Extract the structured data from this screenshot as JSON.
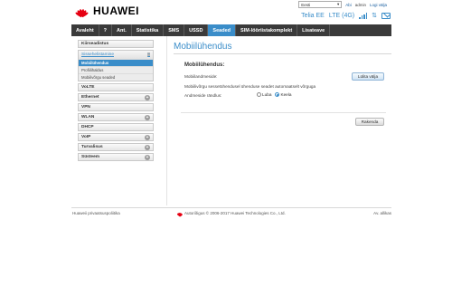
{
  "brand": {
    "name": "HUAWEI",
    "color": "#e60012"
  },
  "topbar": {
    "language": "Eesti",
    "user_label": "Abi",
    "admin": "admin",
    "logout": "Logi välja"
  },
  "status": {
    "operator": "Telia EE",
    "network": "LTE (4G)",
    "icons": [
      "signal-icon",
      "data-transfer-icon",
      "sms-icon"
    ]
  },
  "nav": {
    "items": [
      "Avaleht",
      "?",
      "Ant.",
      "Statistika",
      "SMS",
      "USSD",
      "Seaded",
      "SIM-lööriistakomplekt",
      "Lisateave"
    ],
    "active_index": 6
  },
  "sidebar": {
    "top_item": "Kiirseadistus",
    "group": {
      "label": "Sissehelistamine",
      "subitems": [
        "Mobiilühendus",
        "Profiilihaldus",
        "Mobiilvõrgu seaded"
      ],
      "active_sub": 0
    },
    "items": [
      {
        "label": "VoLTE",
        "expandable": false
      },
      {
        "label": "Ethernet",
        "expandable": true
      },
      {
        "label": "VPN",
        "expandable": false
      },
      {
        "label": "WLAN",
        "expandable": true
      },
      {
        "label": "DHCP",
        "expandable": false
      },
      {
        "label": "VoIP",
        "expandable": true
      },
      {
        "label": "Turvalisus",
        "expandable": true
      },
      {
        "label": "Süsteem",
        "expandable": true
      }
    ]
  },
  "main": {
    "title": "Mobiilühendus",
    "section_title": "Mobiilühendus:",
    "row_data_label": "Mobiilandmeside:",
    "data_button": "Lülita välja",
    "row_note": "Mobiilivõrgu sessetühendusel ühenduse seadet automaatselt võrguga",
    "row_roaming_label": "Andmeside rändlus:",
    "roaming_options": [
      "Luba",
      "Keela"
    ],
    "roaming_selected": 1,
    "apply_button": "Rakenda"
  },
  "footer": {
    "privacy": "Huaweii privaatsuspoliitika",
    "copyright": "Autoriõigus © 2006-2017 Huawei Technologies Co., Ltd.",
    "open_source": "Av. allikas"
  },
  "colors": {
    "accent": "#3a8dc9",
    "nav_bg": "#3a3a3a"
  }
}
